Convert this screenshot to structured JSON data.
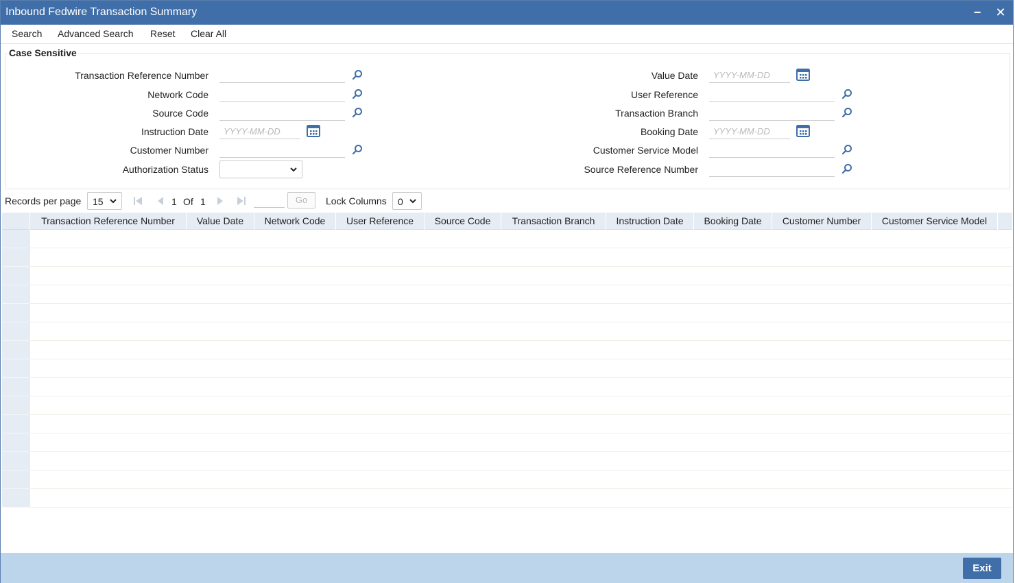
{
  "window": {
    "title": "Inbound Fedwire Transaction Summary",
    "minimize_symbol": "−",
    "close_symbol": "✕"
  },
  "toolbar": {
    "search": "Search",
    "advanced_search": "Advanced Search",
    "reset": "Reset",
    "clear_all": "Clear All"
  },
  "criteria": {
    "legend": "Case Sensitive",
    "date_placeholder": "YYYY-MM-DD",
    "left": {
      "txn_ref": "Transaction Reference Number",
      "network_code": "Network Code",
      "source_code": "Source Code",
      "instruction_date": "Instruction Date",
      "customer_number": "Customer Number",
      "auth_status": "Authorization Status",
      "auth_status_value": ""
    },
    "right": {
      "value_date": "Value Date",
      "user_reference": "User Reference",
      "transaction_branch": "Transaction Branch",
      "booking_date": "Booking Date",
      "customer_service_model": "Customer Service Model",
      "source_reference_number": "Source Reference Number"
    }
  },
  "pager": {
    "records_per_page_label": "Records per page",
    "records_per_page_value": "15",
    "current_page": "1",
    "of_label": "Of",
    "total_pages": "1",
    "go_label": "Go",
    "lock_columns_label": "Lock Columns",
    "lock_columns_value": "0"
  },
  "grid": {
    "columns": [
      "Transaction Reference Number",
      "Value Date",
      "Network Code",
      "User Reference",
      "Source Code",
      "Transaction Branch",
      "Instruction Date",
      "Booking Date",
      "Customer Number",
      "Customer Service Model"
    ],
    "row_count": 15
  },
  "footer": {
    "exit": "Exit"
  },
  "colors": {
    "title_bar": "#3f6ea8",
    "footer": "#bdd5ea",
    "icon_blue": "#3f6ea8",
    "grid_header": "#e6ecf3"
  },
  "icons": {
    "lookup": "search-icon",
    "calendar": "calendar-icon",
    "dropdown": "chevron-down-icon"
  }
}
